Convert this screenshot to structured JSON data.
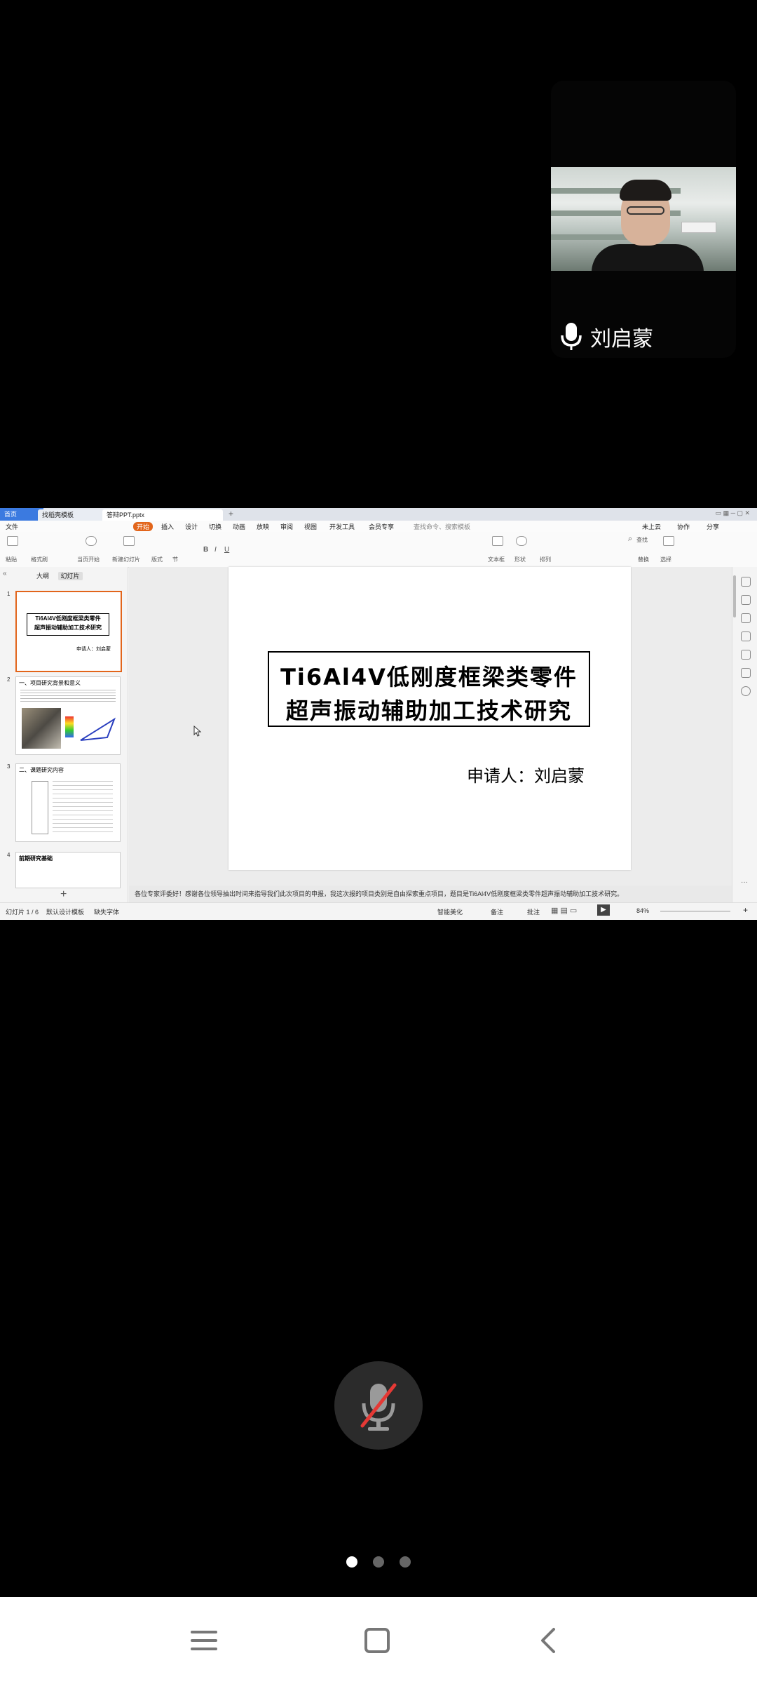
{
  "participant": {
    "name": "刘启蒙"
  },
  "shared_screen": {
    "tabs": [
      {
        "label": "首页"
      },
      {
        "label": "找稻壳模板"
      },
      {
        "label": "答辩PPT.pptx"
      }
    ],
    "menu": {
      "file": "文件",
      "items": [
        "开始",
        "插入",
        "设计",
        "切换",
        "动画",
        "放映",
        "审阅",
        "视图",
        "开发工具",
        "会员专享"
      ],
      "search_placeholder": "查找命令、搜索模板",
      "right_items": [
        "未上云",
        "协作",
        "分享"
      ]
    },
    "toolbar": {
      "labels": [
        "粘贴",
        "格式刷",
        "当页开始",
        "新建幻灯片",
        "版式",
        "节",
        "文本框",
        "形状",
        "排列",
        "查找",
        "替换",
        "选择"
      ]
    },
    "left_pane": {
      "tabs": [
        "大纲",
        "幻灯片"
      ],
      "slides": [
        {
          "num": "1",
          "title_line1": "Ti6Al4V低刚度框梁类零件",
          "title_line2": "超声振动辅助加工技术研究",
          "subtitle": "申请人：刘启蒙"
        },
        {
          "num": "2",
          "head": "一、项目研究背景和意义"
        },
        {
          "num": "3",
          "head": "二、课题研究内容"
        },
        {
          "num": "4",
          "head": "前期研究基础"
        }
      ],
      "add_label": "+"
    },
    "slide": {
      "title_line1": "Ti6Al4V低刚度框梁类零件",
      "title_line2": "超声振动辅助加工技术研究",
      "presenter": "申请人：刘启蒙"
    },
    "notes": "各位专家评委好！感谢各位领导抽出时间来指导我们此次项目的申报，我这次报的项目类别是自由探索重点项目，题目是Ti6Al4V低刚度框梁类零件超声振动辅助加工技术研究。",
    "status": {
      "slide_count": "幻灯片 1 / 6",
      "theme": "默认设计模板",
      "font_missing": "缺失字体",
      "beautify": "智能美化",
      "notes_btn": "备注",
      "comment_btn": "批注",
      "zoom": "84%"
    }
  },
  "page_indicator": {
    "count": 3,
    "active_index": 0
  },
  "colors": {
    "accent_orange": "#e2651b",
    "home_tab_blue": "#3b7ae0",
    "mute_red": "#e53935"
  }
}
